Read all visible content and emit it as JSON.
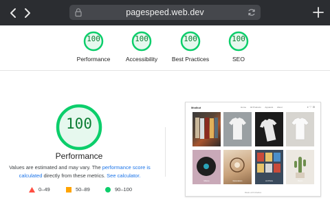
{
  "browser": {
    "url": "pagespeed.web.dev",
    "icons": [
      "back-arrow-icon",
      "forward-arrow-icon",
      "lock-icon",
      "reload-icon",
      "plus-icon"
    ]
  },
  "summary": [
    {
      "score": "100",
      "label": "Performance"
    },
    {
      "score": "100",
      "label": "Accessibility"
    },
    {
      "score": "100",
      "label": "Best Practices"
    },
    {
      "score": "100",
      "label": "SEO"
    }
  ],
  "colors": {
    "pass_green": "#0cce6b",
    "pass_text": "#0a7c32",
    "fail_red": "#ff4e42",
    "average_orange": "#ffa400",
    "link_blue": "#1a73e8"
  },
  "performance": {
    "score": "100",
    "score_fraction": 1.0,
    "title": "Performance",
    "note_prefix": "Values are estimated and may vary. The ",
    "note_link1": "performance score is calculated",
    "note_middle": " directly from these metrics. ",
    "note_link2": "See calculator."
  },
  "legend": [
    {
      "icon": "triangle-icon",
      "range": "0–49"
    },
    {
      "icon": "square-icon",
      "range": "50–89"
    },
    {
      "icon": "circle-icon",
      "range": "90–100"
    }
  ],
  "thumbnail": {
    "logo": "Modkut",
    "nav": [
      "Home",
      "All Products",
      "Apparels",
      "About"
    ],
    "icons": "⌕ ♡ ⊡",
    "tiles": [
      {
        "label": ""
      },
      {
        "label": ""
      },
      {
        "label": ""
      },
      {
        "label": ""
      },
      {
        "label": "Mittens"
      },
      {
        "label": "Decorations"
      },
      {
        "label": "Art Prints"
      },
      {
        "label": "Plants"
      }
    ],
    "footer": "Made with Modkut"
  }
}
